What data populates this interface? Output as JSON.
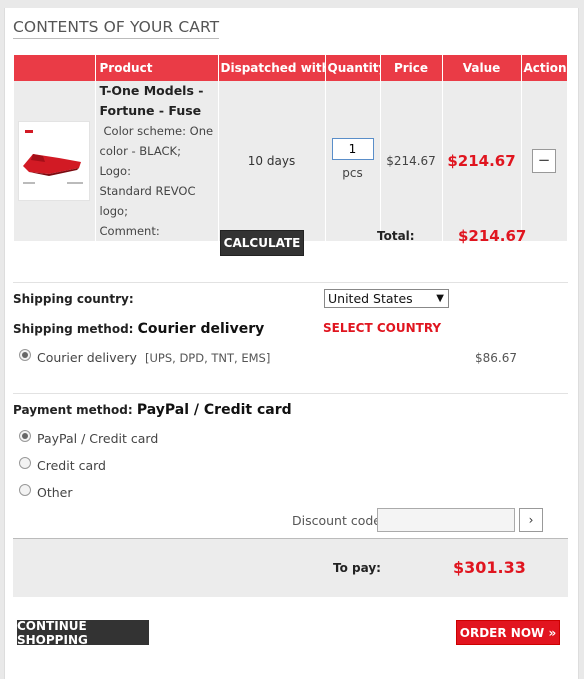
{
  "cart": {
    "heading": "CONTENTS OF YOUR CART",
    "columns": [
      "Product",
      "Dispatched within",
      "Quantity",
      "Price",
      "Value",
      "Actions"
    ],
    "item": {
      "name_line1": "T-One Models -",
      "name_line2": "Fortune - Fuse",
      "desc_line1": "Color scheme: One",
      "desc_line2": "color - BLACK; Logo:",
      "desc_line3": "Standard REVOC logo;",
      "desc_line4": "Comment:",
      "dispatched": "10 days",
      "quantity": "1",
      "unit": "pcs",
      "price": "$214.67",
      "value": "$214.67",
      "remove_symbol": "−"
    },
    "calculate_label": "CALCULATE",
    "total_label": "Total:",
    "total_value": "$214.67"
  },
  "shipping": {
    "country_label": "Shipping country:",
    "country_value": "United States",
    "method_label": "Shipping method:",
    "method_value": "Courier delivery",
    "select_country": "SELECT COUNTRY",
    "option_label": "Courier delivery",
    "option_carriers": "[UPS, DPD, TNT, EMS]",
    "option_price": "$86.67"
  },
  "payment": {
    "method_label": "Payment method:",
    "method_value": "PayPal / Credit card",
    "options": [
      "PayPal / Credit card",
      "Credit card",
      "Other"
    ],
    "discount_label": "Discount code:",
    "discount_value": "",
    "discount_go": "›"
  },
  "summary": {
    "topay_label": "To pay:",
    "topay_value": "$301.33"
  },
  "actions": {
    "continue_label": "CONTINUE SHOPPING",
    "order_label": "ORDER NOW »"
  },
  "colors": {
    "accent": "#ea3b46",
    "price_red": "#e0151f",
    "dark_button": "#333333"
  }
}
